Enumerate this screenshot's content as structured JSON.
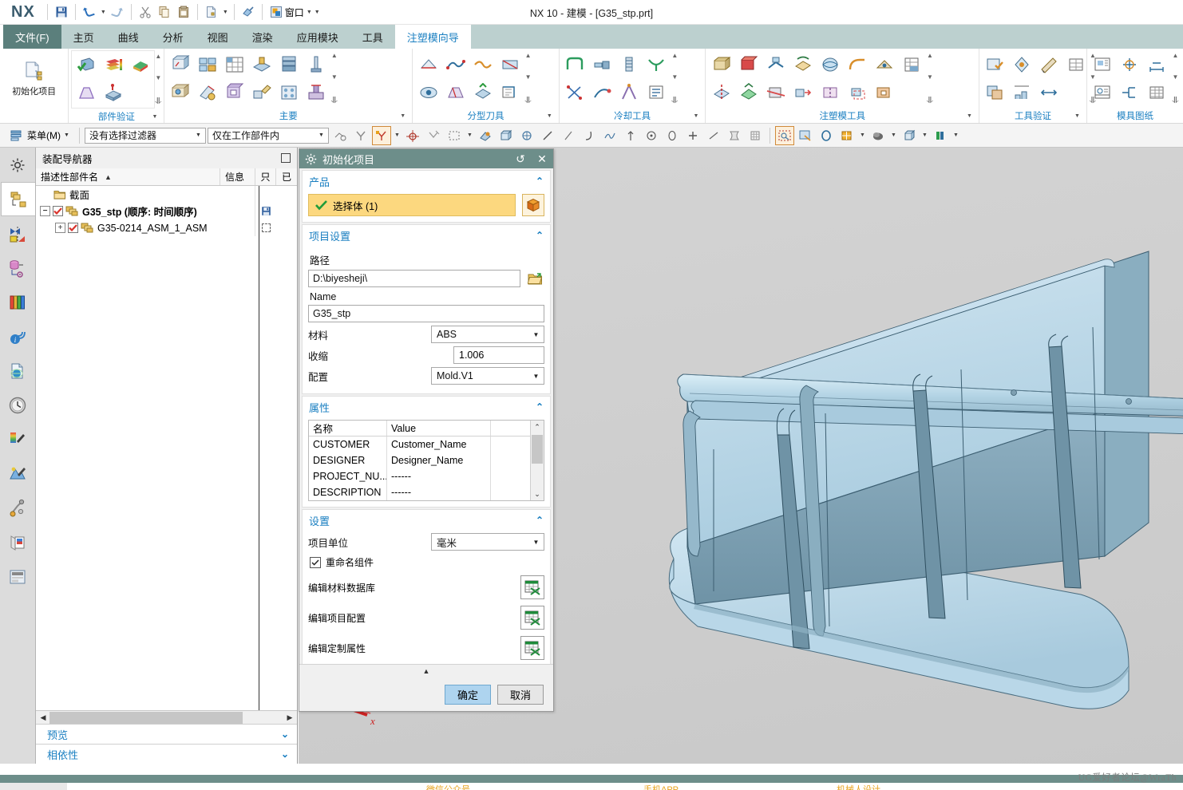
{
  "window": {
    "title": "NX 10 - 建模 - [G35_stp.prt]",
    "logo": "NX"
  },
  "quick_access": {
    "save_label": "保存",
    "undo_label": "撤销",
    "redo_label": "重做",
    "cut_label": "剪切",
    "copy_label": "复制",
    "paste_label": "粘贴",
    "newpart_label": "新建",
    "erase_label": "擦除",
    "window_label": "窗口"
  },
  "tabs": [
    {
      "label": "文件(F)",
      "kind": "file"
    },
    {
      "label": "主页",
      "kind": "normal"
    },
    {
      "label": "曲线",
      "kind": "normal"
    },
    {
      "label": "分析",
      "kind": "normal"
    },
    {
      "label": "视图",
      "kind": "normal"
    },
    {
      "label": "渲染",
      "kind": "normal"
    },
    {
      "label": "应用模块",
      "kind": "normal"
    },
    {
      "label": "工具",
      "kind": "normal"
    },
    {
      "label": "注塑模向导",
      "kind": "active"
    }
  ],
  "ribbon": {
    "init_project_label": "初始化项目",
    "groups": [
      {
        "label": "部件验证",
        "dropdown": "▼"
      },
      {
        "label": "主要",
        "dropdown": "▼"
      },
      {
        "label": "分型刀具",
        "dropdown": "▼"
      },
      {
        "label": "冷却工具",
        "dropdown": "▼"
      },
      {
        "label": "注塑模工具",
        "dropdown": "▼"
      },
      {
        "label": "工具验证",
        "dropdown": "▼"
      },
      {
        "label": "模具图纸",
        "dropdown": ""
      }
    ]
  },
  "toolbar2": {
    "menu_label": "菜单(M)",
    "filter_value": "没有选择过滤器",
    "scope_value": "仅在工作部件内"
  },
  "resource_bar": [
    {
      "name": "assembly-navigator",
      "label": "装配导航器"
    },
    {
      "name": "constraint-navigator",
      "label": "约束导航器"
    },
    {
      "name": "part-navigator",
      "label": "部件导航器"
    },
    {
      "name": "reuse-library",
      "label": "重用库"
    },
    {
      "name": "hd3d-tools",
      "label": "HD3D 工具"
    },
    {
      "name": "web-browser",
      "label": "Web 浏览器"
    },
    {
      "name": "history",
      "label": "历史记录"
    },
    {
      "name": "system-materials",
      "label": "系统材料"
    },
    {
      "name": "system-scenes",
      "label": "系统场景"
    },
    {
      "name": "process-studio",
      "label": "加工特征导航器"
    },
    {
      "name": "roles",
      "label": "角色"
    },
    {
      "name": "view-manager",
      "label": "视图管理器导航器"
    }
  ],
  "navigator": {
    "title": "装配导航器",
    "columns": [
      "描述性部件名",
      "信息",
      "只",
      "已"
    ],
    "sort_arrow": "▲",
    "rows": [
      {
        "label": "截面",
        "indent": 1,
        "expand": "",
        "checked": false,
        "icon": "folder-icon",
        "bold": false,
        "status": ""
      },
      {
        "label": "G35_stp (顺序: 时间顺序)",
        "indent": 0,
        "expand": "-",
        "checked": true,
        "icon": "assembly-icon",
        "bold": true,
        "status": "save"
      },
      {
        "label": "G35-0214_ASM_1_ASM",
        "indent": 1,
        "expand": "+",
        "checked": true,
        "icon": "assembly-icon",
        "bold": false,
        "status": "dashed"
      }
    ],
    "preview_label": "预览",
    "dependency_label": "相依性"
  },
  "dialog": {
    "title": "初始化项目",
    "reset_label": "重置",
    "close_label": "关闭",
    "product": {
      "header": "产品",
      "select_body_label": "选择体 (1)",
      "cube_icon": "solid-body-icon"
    },
    "project_settings": {
      "header": "项目设置",
      "path_label": "路径",
      "path_value": "D:\\biyesheji\\",
      "name_label": "Name",
      "name_value": "G35_stp",
      "material_label": "材料",
      "material_value": "ABS",
      "shrink_label": "收缩",
      "shrink_value": "1.006",
      "config_label": "配置",
      "config_value": "Mold.V1"
    },
    "attributes": {
      "header": "属性",
      "columns": [
        "名称",
        "Value",
        ""
      ],
      "rows": [
        {
          "name": "CUSTOMER",
          "value": "Customer_Name",
          "extra": ""
        },
        {
          "name": "DESIGNER",
          "value": "Designer_Name",
          "extra": ""
        },
        {
          "name": "PROJECT_NU...",
          "value": "------",
          "extra": ""
        },
        {
          "name": "DESCRIPTION",
          "value": "------",
          "extra": ""
        }
      ]
    },
    "settings": {
      "header": "设置",
      "unit_label": "项目单位",
      "unit_value": "毫米",
      "rename_label": "重命名组件",
      "rename_checked": true,
      "edit_material_db_label": "编辑材料数据库",
      "edit_project_config_label": "编辑项目配置",
      "edit_custom_attr_label": "编辑定制属性"
    },
    "ok_label": "确定",
    "cancel_label": "取消"
  },
  "bottom": {
    "item1": "微信公众号",
    "item2": "手机APP",
    "item3": "机械人设计",
    "watermark": "UG爱好者论坛@WraTh"
  },
  "colors": {
    "accent_teal": "#6d8e8a",
    "link_blue": "#1a7fc1",
    "tab_bar": "#bcd0cf",
    "select_gold": "#fcd87f",
    "ok_button": "#aed4ef",
    "model_light": "#bcd9ea",
    "model_dark": "#7d9aab"
  }
}
